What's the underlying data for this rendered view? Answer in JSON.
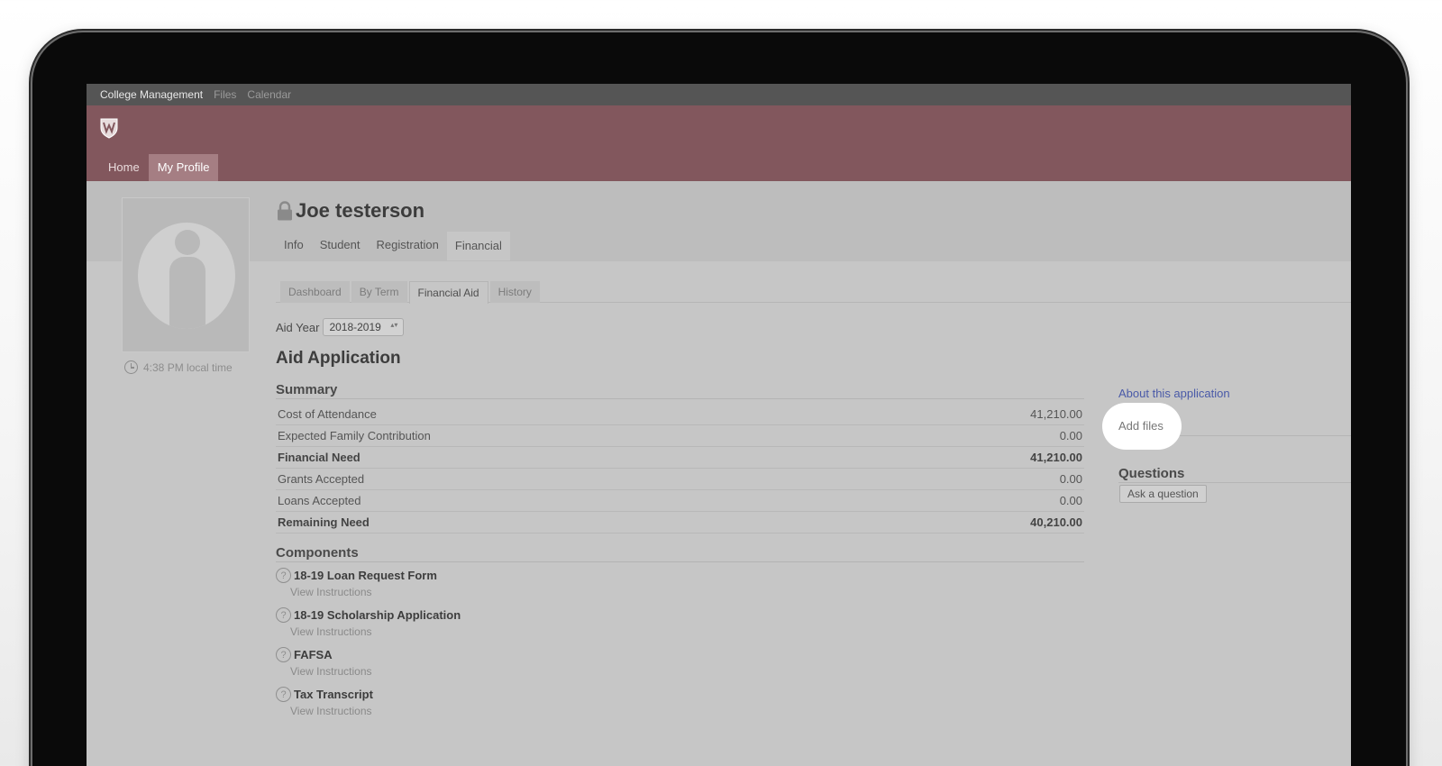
{
  "topbar": {
    "app": "College Management",
    "links": [
      "Files",
      "Calendar"
    ]
  },
  "nav": {
    "home": "Home",
    "my_profile": "My Profile"
  },
  "profile": {
    "name": "Joe testerson",
    "local_time": "4:38 PM local time",
    "tabs": [
      "Info",
      "Student",
      "Registration",
      "Financial"
    ],
    "active_tab": "Financial"
  },
  "subtabs": {
    "items": [
      "Dashboard",
      "By Term",
      "Financial Aid",
      "History"
    ],
    "active": "Financial Aid"
  },
  "aid_year": {
    "label": "Aid Year",
    "value": "2018-2019"
  },
  "application": {
    "title": "Aid Application",
    "summary_heading": "Summary",
    "summary": [
      {
        "label": "Cost of Attendance",
        "value": "41,210.00",
        "bold": false
      },
      {
        "label": "Expected Family Contribution",
        "value": "0.00",
        "bold": false
      },
      {
        "label": "Financial Need",
        "value": "41,210.00",
        "bold": true
      },
      {
        "label": "Grants Accepted",
        "value": "0.00",
        "bold": false
      },
      {
        "label": "Loans Accepted",
        "value": "0.00",
        "bold": false
      },
      {
        "label": "Remaining Need",
        "value": "40,210.00",
        "bold": true
      }
    ],
    "components_heading": "Components",
    "components": [
      {
        "title": "18-19 Loan Request Form",
        "link": "View Instructions"
      },
      {
        "title": "18-19 Scholarship Application",
        "link": "View Instructions"
      },
      {
        "title": "FAFSA",
        "link": "View Instructions"
      },
      {
        "title": "Tax Transcript",
        "link": "View Instructions"
      }
    ]
  },
  "sidebar": {
    "about_link": "About this application",
    "add_files": "Add files",
    "questions_heading": "Questions",
    "ask_button": "Ask a question"
  },
  "icons": {
    "help": "?"
  },
  "colors": {
    "banner": "#82575d",
    "topbar": "#555555",
    "link": "#4a5aa8",
    "overlay": "#c6c6c6"
  }
}
